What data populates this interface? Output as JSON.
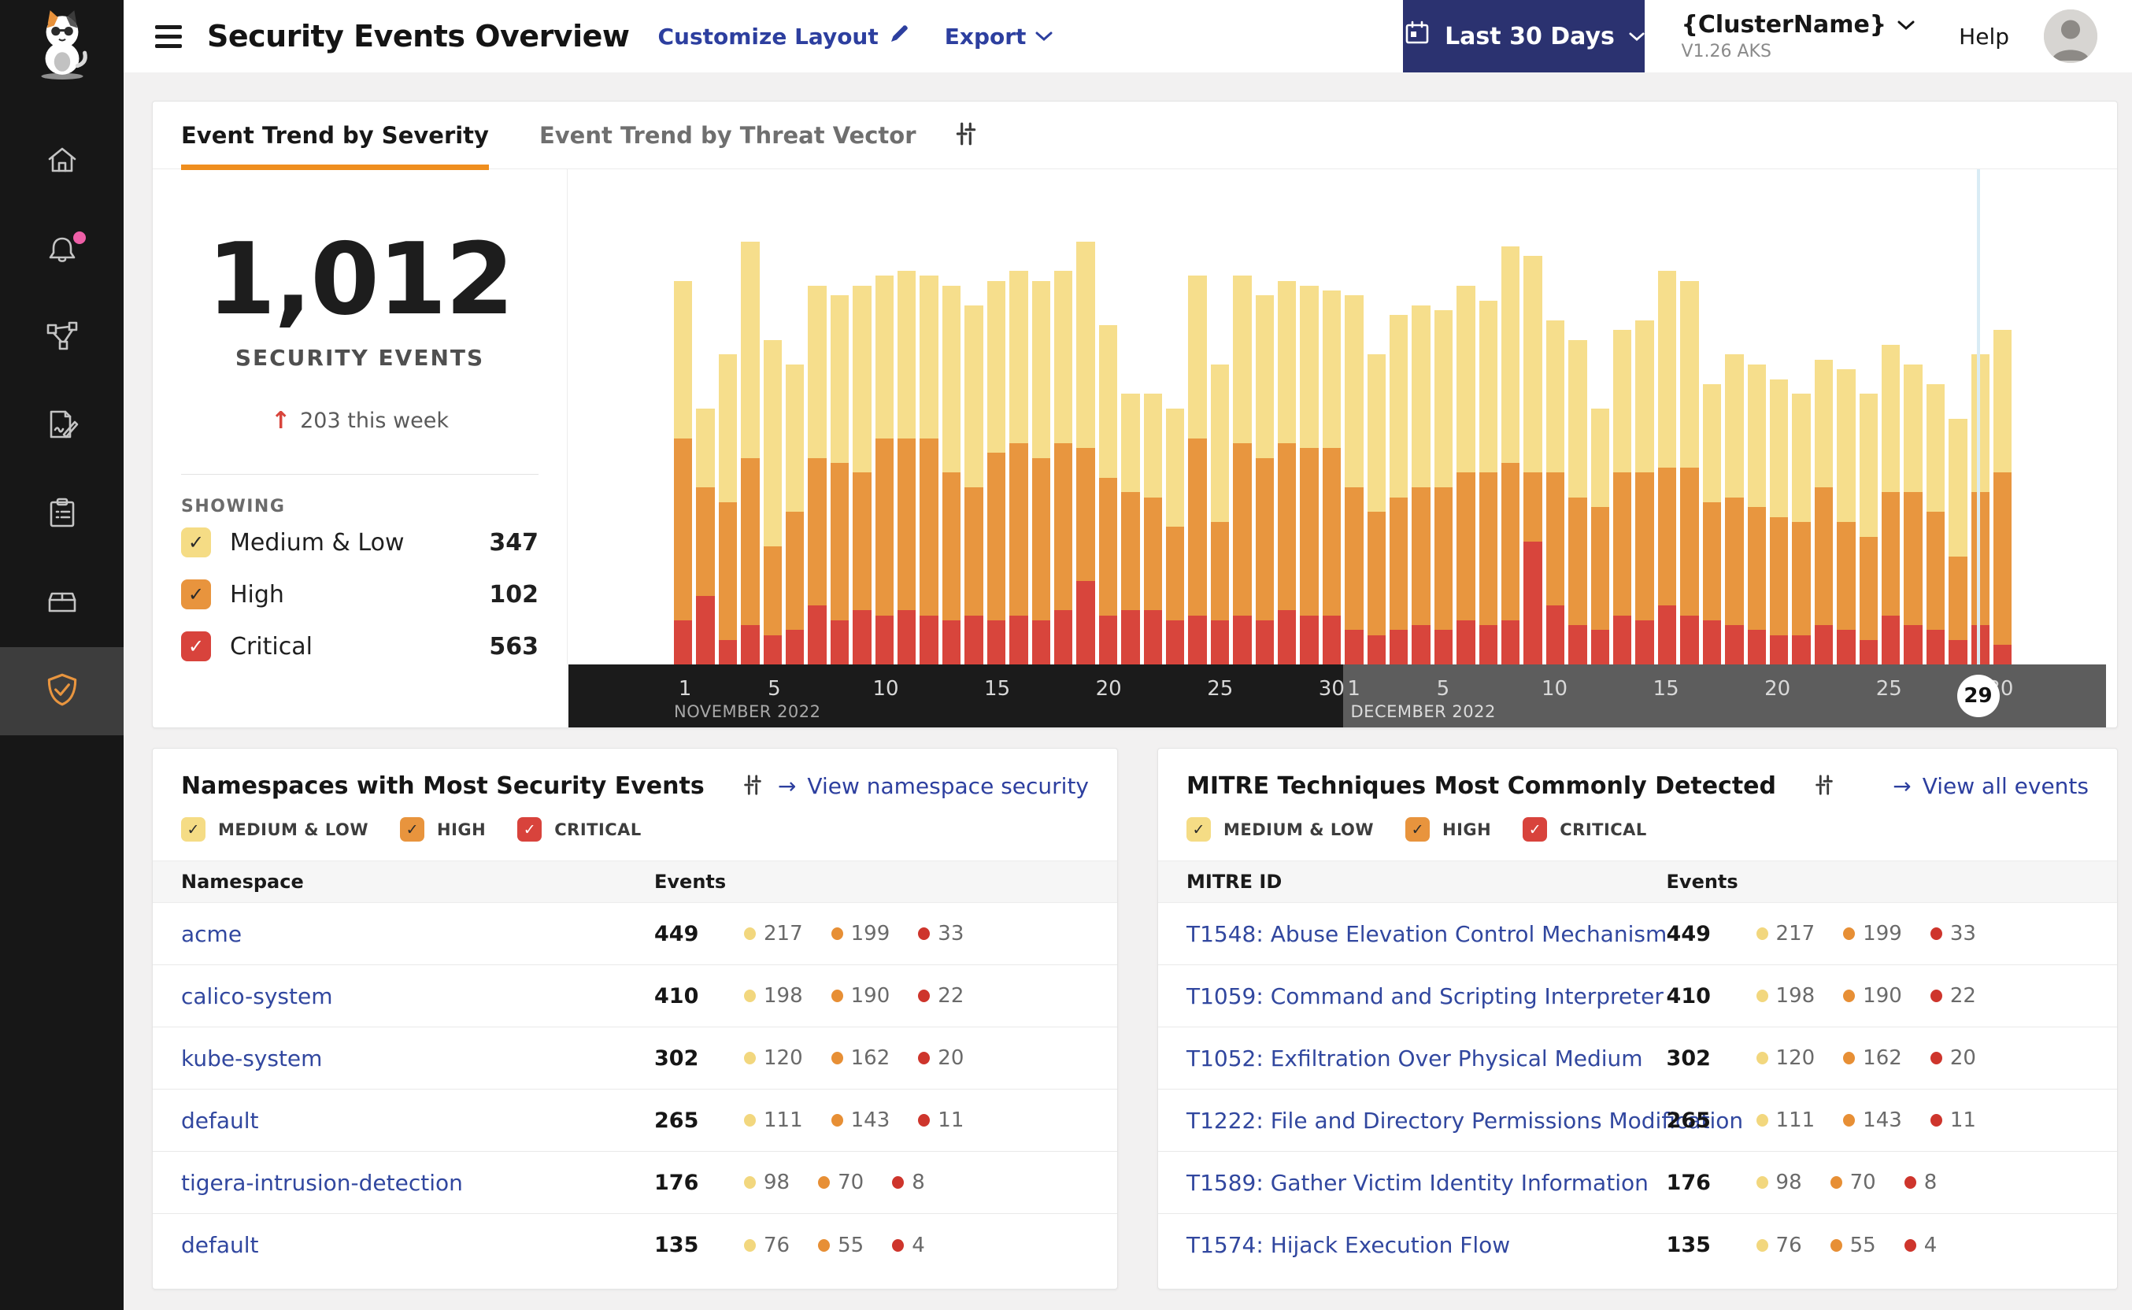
{
  "colors": {
    "accent_orange": "#EF8E1E",
    "link_blue": "#2D3F9F",
    "date_button_bg": "#2B3270",
    "sidebar_bg": "#171717",
    "severity": {
      "medium_low": "#F5DC85",
      "high": "#E8943D",
      "critical": "#D8433C"
    },
    "notification_dot": "#EE5FA7"
  },
  "sidebar": {
    "items": [
      {
        "icon": "calico-cat-logo"
      },
      {
        "icon": "home-icon"
      },
      {
        "icon": "alerts-bell-icon",
        "notification_dot": true
      },
      {
        "icon": "service-graph-icon"
      },
      {
        "icon": "policies-edit-icon"
      },
      {
        "icon": "compliance-clipboard-icon"
      },
      {
        "icon": "image-assurance-box-icon"
      },
      {
        "icon": "threat-defense-shield-icon",
        "active": true
      }
    ]
  },
  "header": {
    "title": "Security Events Overview",
    "customize_label": "Customize Layout",
    "export_label": "Export",
    "date_range_label": "Last 30 Days",
    "cluster_name": "{ClusterName}",
    "cluster_version": "V1.26 AKS",
    "help_label": "Help"
  },
  "tabs": {
    "active": "Event Trend by Severity",
    "inactive": "Event Trend by Threat Vector"
  },
  "summary": {
    "total": "1,012",
    "caption": "SECURITY EVENTS",
    "delta_arrow": "↑",
    "delta": "203 this week",
    "showing_label": "SHOWING",
    "filters": [
      {
        "label": "Medium & Low",
        "value": "347",
        "severity": "medium_low"
      },
      {
        "label": "High",
        "value": "102",
        "severity": "high"
      },
      {
        "label": "Critical",
        "value": "563",
        "severity": "critical"
      }
    ]
  },
  "chart_data": {
    "type": "bar",
    "stacked": true,
    "series_order_bottom_to_top": [
      "critical",
      "high",
      "medium_low"
    ],
    "legend": [
      "Medium & Low",
      "High",
      "Critical"
    ],
    "colors": {
      "medium_low": "#F6DE8C",
      "high": "#E8963F",
      "critical": "#D8453C"
    },
    "x_axis": {
      "months": [
        {
          "label": "NOVEMBER 2022",
          "ticks": [
            1,
            5,
            10,
            15,
            20,
            25,
            30
          ]
        },
        {
          "label": "DECEMBER 2022",
          "ticks": [
            1,
            5,
            10,
            15,
            20,
            25,
            30
          ]
        }
      ],
      "current_day_marker": {
        "month": "DECEMBER 2022",
        "day": 29
      }
    },
    "y_axis": "unlabeled",
    "bar_count": 60,
    "bar_format": [
      "date",
      "critical",
      "high",
      "medium_low"
    ],
    "note": "values are relative stacked heights in % of plot height, estimated from pixels",
    "bars": [
      [
        "Nov 1",
        9,
        37,
        32
      ],
      [
        "Nov 2",
        14,
        22,
        16
      ],
      [
        "Nov 3",
        5,
        28,
        30
      ],
      [
        "Nov 4",
        8,
        34,
        44
      ],
      [
        "Nov 5",
        6,
        18,
        42
      ],
      [
        "Nov 6",
        7,
        24,
        30
      ],
      [
        "Nov 7",
        12,
        30,
        35
      ],
      [
        "Nov 8",
        9,
        32,
        34
      ],
      [
        "Nov 9",
        11,
        28,
        38
      ],
      [
        "Nov 10",
        10,
        36,
        33
      ],
      [
        "Nov 11",
        11,
        35,
        34
      ],
      [
        "Nov 12",
        10,
        36,
        33
      ],
      [
        "Nov 13",
        9,
        30,
        38
      ],
      [
        "Nov 14",
        10,
        26,
        37
      ],
      [
        "Nov 15",
        9,
        34,
        35
      ],
      [
        "Nov 16",
        10,
        35,
        35
      ],
      [
        "Nov 17",
        9,
        33,
        36
      ],
      [
        "Nov 18",
        11,
        34,
        35
      ],
      [
        "Nov 19",
        17,
        27,
        42
      ],
      [
        "Nov 20",
        10,
        28,
        31
      ],
      [
        "Nov 21",
        11,
        24,
        20
      ],
      [
        "Nov 22",
        11,
        23,
        21
      ],
      [
        "Nov 23",
        9,
        19,
        24
      ],
      [
        "Nov 24",
        10,
        36,
        33
      ],
      [
        "Nov 25",
        9,
        20,
        32
      ],
      [
        "Nov 26",
        10,
        35,
        34
      ],
      [
        "Nov 27",
        9,
        33,
        33
      ],
      [
        "Nov 28",
        11,
        34,
        33
      ],
      [
        "Nov 29",
        10,
        34,
        33
      ],
      [
        "Nov 30",
        10,
        34,
        32
      ],
      [
        "Dec 1",
        7,
        29,
        39
      ],
      [
        "Dec 2",
        6,
        25,
        32
      ],
      [
        "Dec 3",
        7,
        27,
        37
      ],
      [
        "Dec 4",
        8,
        28,
        37
      ],
      [
        "Dec 5",
        7,
        29,
        36
      ],
      [
        "Dec 6",
        9,
        30,
        38
      ],
      [
        "Dec 7",
        8,
        31,
        35
      ],
      [
        "Dec 8",
        9,
        32,
        44
      ],
      [
        "Dec 9",
        25,
        14,
        44
      ],
      [
        "Dec 10",
        12,
        27,
        31
      ],
      [
        "Dec 11",
        8,
        26,
        32
      ],
      [
        "Dec 12",
        7,
        25,
        20
      ],
      [
        "Dec 13",
        10,
        29,
        29
      ],
      [
        "Dec 14",
        9,
        30,
        31
      ],
      [
        "Dec 15",
        12,
        28,
        40
      ],
      [
        "Dec 16",
        10,
        30,
        38
      ],
      [
        "Dec 17",
        9,
        24,
        24
      ],
      [
        "Dec 18",
        8,
        26,
        29
      ],
      [
        "Dec 19",
        7,
        25,
        29
      ],
      [
        "Dec 20",
        6,
        24,
        28
      ],
      [
        "Dec 21",
        6,
        23,
        26
      ],
      [
        "Dec 22",
        8,
        28,
        26
      ],
      [
        "Dec 23",
        7,
        22,
        31
      ],
      [
        "Dec 24",
        5,
        21,
        29
      ],
      [
        "Dec 25",
        10,
        25,
        30
      ],
      [
        "Dec 26",
        8,
        27,
        26
      ],
      [
        "Dec 27",
        7,
        24,
        26
      ],
      [
        "Dec 28",
        5,
        17,
        28
      ],
      [
        "Dec 29",
        8,
        27,
        28
      ],
      [
        "Dec 30",
        4,
        35,
        29
      ]
    ]
  },
  "namespaces_panel": {
    "title": "Namespaces with Most Security Events",
    "link": "View namespace security",
    "link_arrow": "→",
    "filters": [
      "MEDIUM & LOW",
      "HIGH",
      "CRITICAL"
    ],
    "columns": [
      "Namespace",
      "Events"
    ],
    "rows": [
      {
        "name": "acme",
        "total": "449",
        "medium_low": "217",
        "high": "199",
        "critical": "33"
      },
      {
        "name": "calico-system",
        "total": "410",
        "medium_low": "198",
        "high": "190",
        "critical": "22"
      },
      {
        "name": "kube-system",
        "total": "302",
        "medium_low": "120",
        "high": "162",
        "critical": "20"
      },
      {
        "name": "default",
        "total": "265",
        "medium_low": "111",
        "high": "143",
        "critical": "11"
      },
      {
        "name": "tigera-intrusion-detection",
        "total": "176",
        "medium_low": "98",
        "high": "70",
        "critical": "8"
      },
      {
        "name": "default",
        "total": "135",
        "medium_low": "76",
        "high": "55",
        "critical": "4"
      }
    ]
  },
  "mitre_panel": {
    "title": "MITRE Techniques Most Commonly Detected",
    "link": "View all events",
    "link_arrow": "→",
    "filters": [
      "MEDIUM & LOW",
      "HIGH",
      "CRITICAL"
    ],
    "columns": [
      "MITRE ID",
      "Events"
    ],
    "rows": [
      {
        "name": "T1548: Abuse Elevation Control Mechanism",
        "total": "449",
        "medium_low": "217",
        "high": "199",
        "critical": "33"
      },
      {
        "name": "T1059: Command and Scripting Interpreter",
        "total": "410",
        "medium_low": "198",
        "high": "190",
        "critical": "22"
      },
      {
        "name": "T1052: Exfiltration Over Physical Medium",
        "total": "302",
        "medium_low": "120",
        "high": "162",
        "critical": "20"
      },
      {
        "name": "T1222: File and Directory Permissions Modification",
        "total": "265",
        "medium_low": "111",
        "high": "143",
        "critical": "11"
      },
      {
        "name": "T1589: Gather Victim Identity Information",
        "total": "176",
        "medium_low": "98",
        "high": "70",
        "critical": "8"
      },
      {
        "name": "T1574: Hijack Execution Flow",
        "total": "135",
        "medium_low": "76",
        "high": "55",
        "critical": "4"
      }
    ]
  }
}
